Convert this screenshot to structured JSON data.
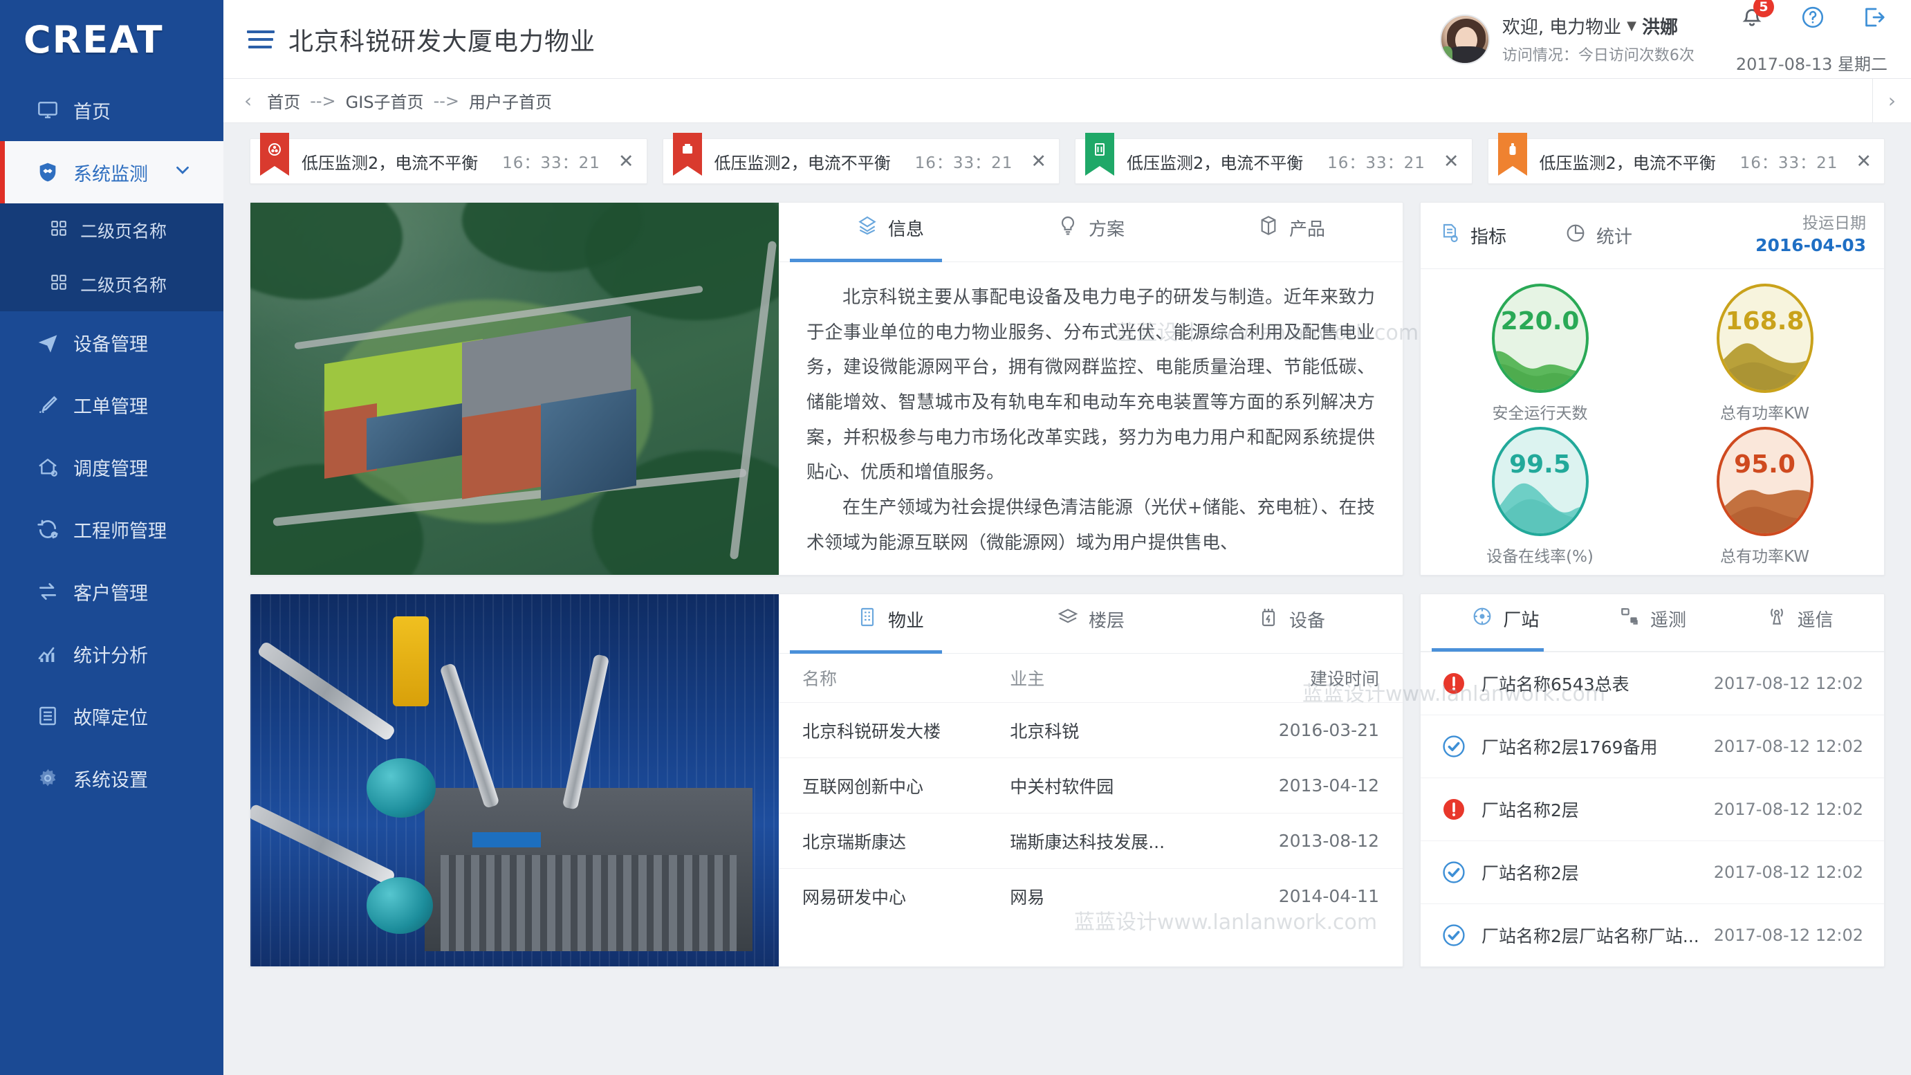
{
  "brand": {
    "logo": "CREAT"
  },
  "header": {
    "menu_icon": "hamburger-icon",
    "title": "北京科锐研发大厦电力物业",
    "welcome_prefix": "欢迎,",
    "org": "电力物业",
    "caret": "▼",
    "user_name": "洪娜",
    "visit_info": "访问情况：今日访问次数6次",
    "notification_count": "5",
    "date": "2017-08-13  星期二"
  },
  "breadcrumb": {
    "back": "‹",
    "forward": "›",
    "items": [
      "首页",
      "GIS子首页",
      "用户子首页"
    ],
    "separator": "-->"
  },
  "sidebar": {
    "home": {
      "label": "首页",
      "icon": "monitor-icon"
    },
    "active": {
      "label": "系统监测",
      "icon": "shield-handshake-icon",
      "chevron": "chevron-down-icon"
    },
    "sub_items": [
      {
        "label": "二级页名称",
        "icon": "grid-icon"
      },
      {
        "label": "二级页名称",
        "icon": "grid-icon"
      }
    ],
    "items": [
      {
        "label": "设备管理",
        "icon": "paper-plane-icon"
      },
      {
        "label": "工单管理",
        "icon": "pencil-icon"
      },
      {
        "label": "调度管理",
        "icon": "home-gear-icon"
      },
      {
        "label": "工程师管理",
        "icon": "refresh-gear-icon"
      },
      {
        "label": "客户管理",
        "icon": "exchange-icon"
      },
      {
        "label": "统计分析",
        "icon": "chart-up-icon"
      },
      {
        "label": "故障定位",
        "icon": "list-doc-icon"
      },
      {
        "label": "系统设置",
        "icon": "gear-icon"
      }
    ]
  },
  "alerts": [
    {
      "text": "低压监测2，电流不平衡",
      "time": "16：33：21",
      "color": "#d93a2e",
      "icon": "valve-icon",
      "close": "✕"
    },
    {
      "text": "低压监测2，电流不平衡",
      "time": "16：33：21",
      "color": "#d93a2e",
      "icon": "meter-icon",
      "close": "✕"
    },
    {
      "text": "低压监测2，电流不平衡",
      "time": "16：33：21",
      "color": "#1fa868",
      "icon": "cabinet-icon",
      "close": "✕"
    },
    {
      "text": "低压监测2，电流不平衡",
      "time": "16：33：21",
      "color": "#ef8230",
      "icon": "bottle-icon",
      "close": "✕"
    }
  ],
  "info_card": {
    "tabs": [
      {
        "label": "信息",
        "icon": "layers-diamond-icon",
        "active": true
      },
      {
        "label": "方案",
        "icon": "bulb-icon",
        "active": false
      },
      {
        "label": "产品",
        "icon": "box-icon",
        "active": false
      }
    ],
    "paragraphs": [
      "北京科锐主要从事配电设备及电力电子的研发与制造。近年来致力于企事业单位的电力物业服务、分布式光伏、能源综合利用及配售电业务，建设微能源网平台，拥有微网群监控、电能质量治理、节能低碳、储能增效、智慧城市及有轨电车和电动车充电装置等方面的系列解决方案，并积极参与电力市场化改革实践，努力为电力用户和配网系统提供贴心、优质和增值服务。",
      "在生产领域为社会提供绿色清洁能源（光伏+储能、充电桩）、在技术领域为能源互联网（微能源网）域为用户提供售电、"
    ],
    "image_alt": "北京科锐研发大厦航拍效果图"
  },
  "indicator_card": {
    "tabs": [
      {
        "label": "指标",
        "icon": "document-gear-icon",
        "active": true
      },
      {
        "label": "统计",
        "icon": "pie-chart-icon",
        "active": false
      }
    ],
    "date_label": "投运日期",
    "date_value": "2016-04-03",
    "gauges": [
      {
        "value": "220.0",
        "label": "安全运行天数",
        "color": "#2aa956",
        "fill": "#5cb85c",
        "bg": "#e6f4e4"
      },
      {
        "value": "168.8",
        "label": "总有功率KW",
        "color": "#c9a21b",
        "fill": "#b9a13a",
        "bg": "#f7f4dd"
      },
      {
        "value": "99.5",
        "label": "设备在线率(%)",
        "color": "#22a99a",
        "fill": "#6ecfc6",
        "bg": "#dcf3f0"
      },
      {
        "value": "95.0",
        "label": "总有功率KW",
        "color": "#cf4a1f",
        "fill": "#c3713f",
        "bg": "#fae7da"
      }
    ]
  },
  "property_card": {
    "tabs": [
      {
        "label": "物业",
        "icon": "building-icon",
        "active": true
      },
      {
        "label": "楼层",
        "icon": "layers-icon",
        "active": false
      },
      {
        "label": "设备",
        "icon": "device-bolt-icon",
        "active": false
      }
    ],
    "columns": [
      "名称",
      "业主",
      "建设时间"
    ],
    "rows": [
      [
        "北京科锐研发大楼",
        "北京科锐",
        "2016-03-21"
      ],
      [
        "互联网创新中心",
        "中关村软件园",
        "2013-04-12"
      ],
      [
        "北京瑞斯康达",
        "瑞斯康达科技发展...",
        "2013-08-12"
      ],
      [
        "网易研发中心",
        "网易",
        "2014-04-11"
      ]
    ],
    "image_alt": "西门子变压器设备照片"
  },
  "station_card": {
    "tabs": [
      {
        "label": "厂站",
        "icon": "station-icon",
        "active": true
      },
      {
        "label": "遥测",
        "icon": "telemetry-icon",
        "active": false
      },
      {
        "label": "遥信",
        "icon": "signal-icon",
        "active": false
      }
    ],
    "rows": [
      {
        "status": "alarm",
        "name": "厂站名称6543总表",
        "time": "2017-08-12 12:02"
      },
      {
        "status": "ok",
        "name": "厂站名称2层1769备用",
        "time": "2017-08-12 12:02"
      },
      {
        "status": "alarm",
        "name": "厂站名称2层",
        "time": "2017-08-12 12:02"
      },
      {
        "status": "ok",
        "name": "厂站名称2层",
        "time": "2017-08-12 12:02"
      },
      {
        "status": "ok",
        "name": "厂站名称2层厂站名称厂站...",
        "time": "2017-08-12 12:02"
      }
    ]
  },
  "watermarks": [
    "蓝蓝设计www.lanlanwork.com",
    "蓝蓝设计www.lanlanwork.com",
    "蓝蓝设计www.lanlanwork.com"
  ],
  "colors": {
    "brand_blue": "#1b4a94",
    "accent_blue": "#4a90d9",
    "alert_red": "#e8372b",
    "ok_blue": "#3d8fd6"
  }
}
